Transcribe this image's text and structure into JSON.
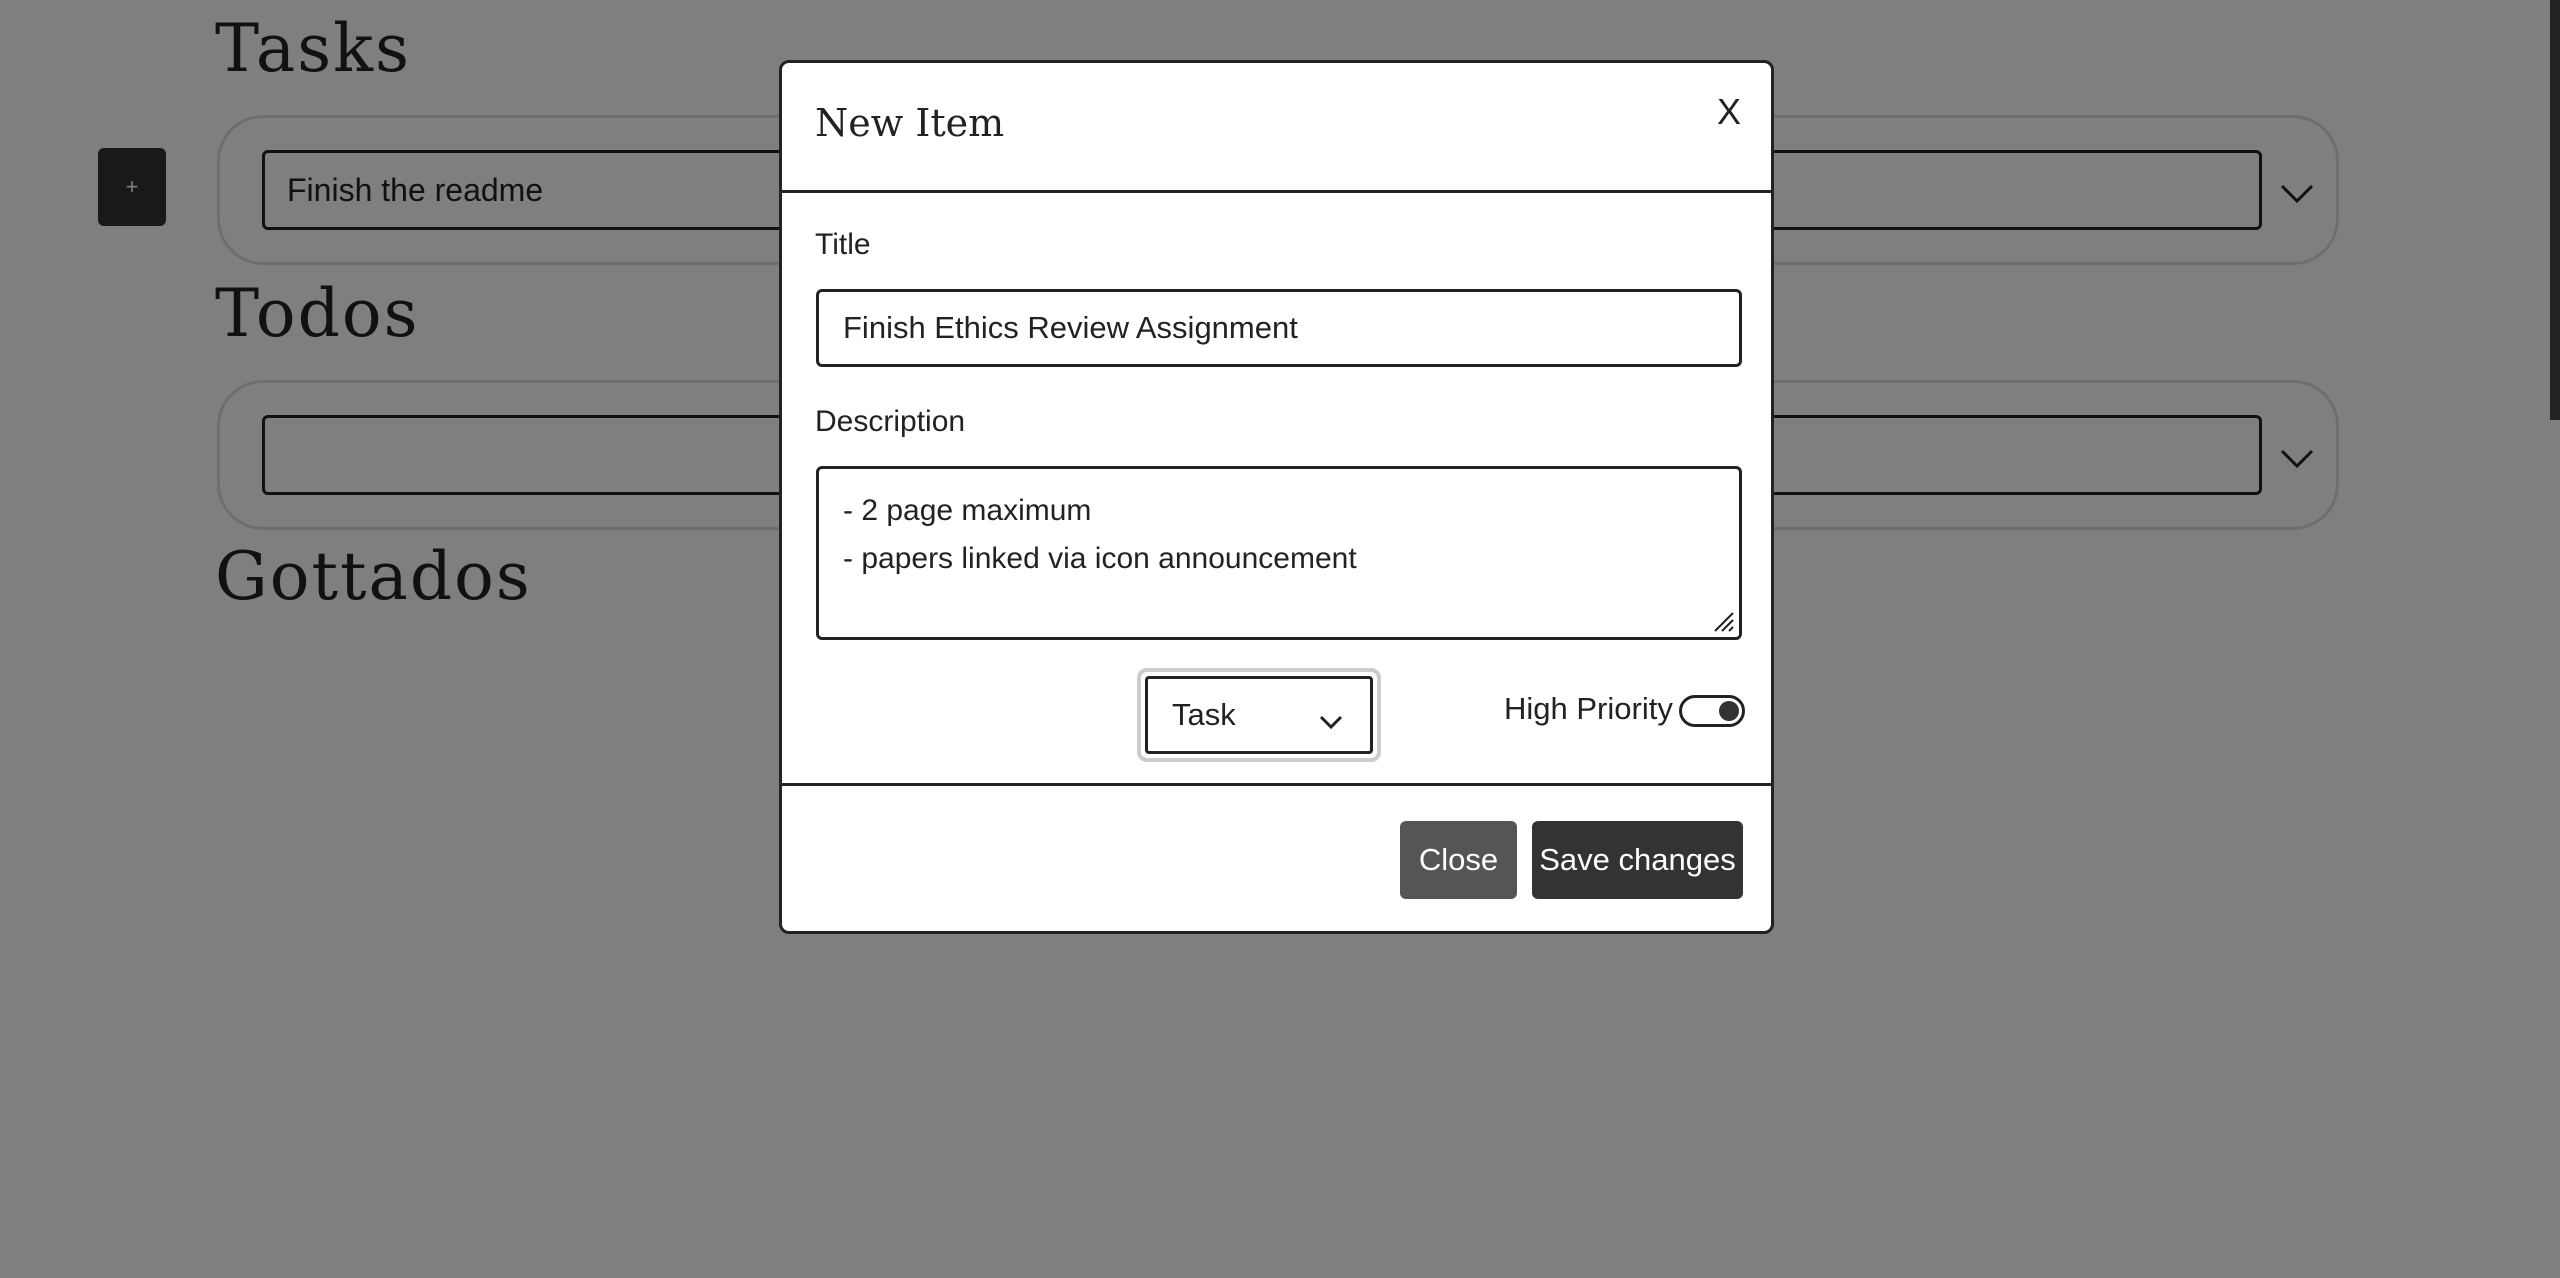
{
  "page": {
    "add_button_label": "+",
    "sections": [
      {
        "title": "Tasks",
        "selected_item": "Finish the readme"
      },
      {
        "title": "Todos",
        "selected_item": ""
      },
      {
        "title": "Gottados"
      }
    ]
  },
  "modal": {
    "title": "New Item",
    "close_x": "X",
    "title_label": "Title",
    "title_value": "Finish Ethics Review Assignment",
    "description_label": "Description",
    "description_lines": [
      "- 2 page maximum",
      "- papers linked via icon announcement"
    ],
    "type_value": "Task",
    "priority_label": "High Priority",
    "priority_on": true,
    "close_button": "Close",
    "save_button": "Save changes"
  },
  "icons": {
    "chevron": "chevron-down-icon",
    "resize": "resize-handle-icon"
  }
}
